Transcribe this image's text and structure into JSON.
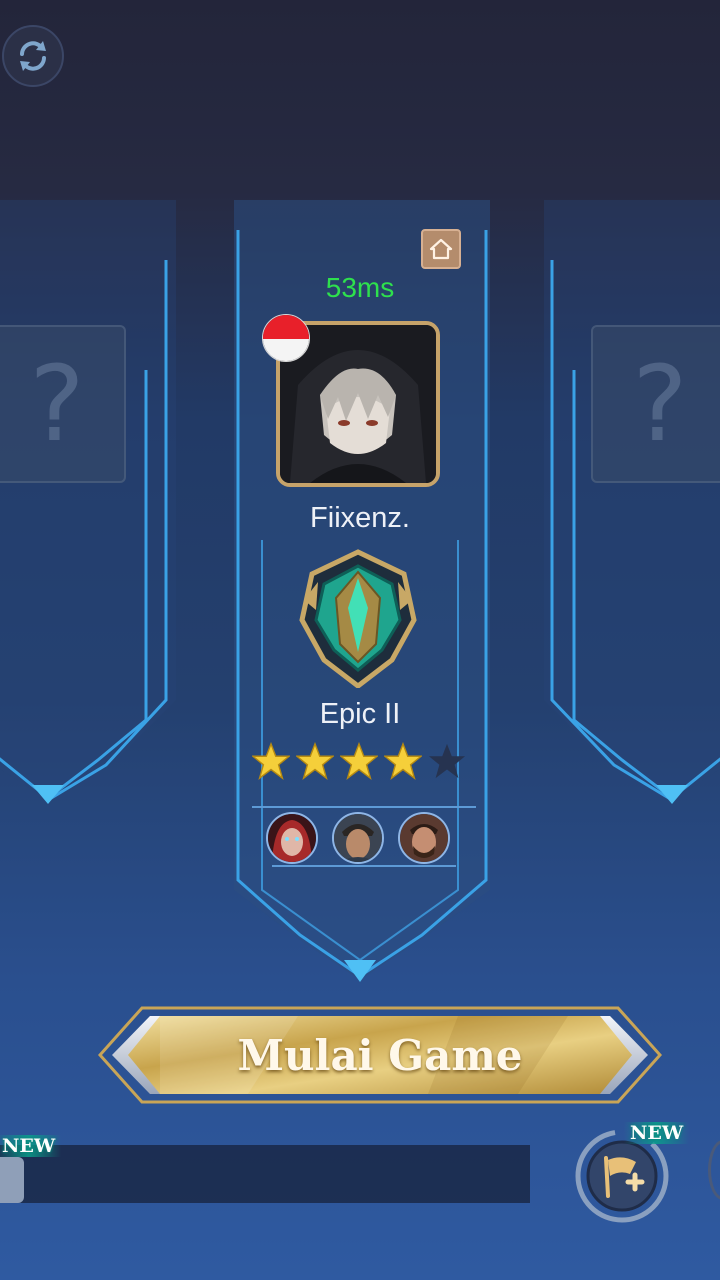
{
  "top_bar": {
    "refresh_icon": "refresh-icon"
  },
  "lobby": {
    "left_slot": {
      "placeholder": "?"
    },
    "right_slot": {
      "placeholder": "?"
    },
    "player": {
      "ping": "53ms",
      "name": "Fiixenz.",
      "rank": "Epic II",
      "stars_filled": 4,
      "stars_total": 5,
      "flag": "indonesia-flag",
      "home_icon": "home-icon",
      "heroes": [
        "hero-portrait-red-hair",
        "hero-portrait-dark-hair",
        "hero-portrait-beard"
      ]
    }
  },
  "actions": {
    "start_label": "Mulai Game",
    "new_badge_left": "NEW",
    "new_badge_right": "NEW",
    "create_team_icon": "flag-plus-icon"
  },
  "colors": {
    "ping": "#2ee04d",
    "gold": "#d8b55a",
    "card_edge": "#3aa2e6"
  }
}
